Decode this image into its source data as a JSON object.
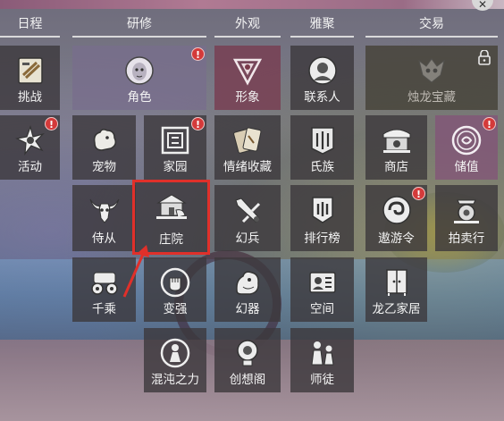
{
  "headers": {
    "schedule": "日程",
    "training": "研修",
    "appearance": "外观",
    "gathering": "雅聚",
    "trade": "交易"
  },
  "tiles": {
    "challenge": "挑战",
    "character": "角色",
    "image": "形象",
    "contacts": "联系人",
    "dragon_treasure": "烛龙宝藏",
    "activity": "活动",
    "pet": "宠物",
    "home": "家园",
    "emotion_collection": "情绪收藏",
    "clan": "氏族",
    "shop": "商店",
    "recharge": "储值",
    "attendant": "侍从",
    "manor": "庄院",
    "phantom_weapon": "幻兵",
    "leaderboard": "排行榜",
    "travel_token": "遨游令",
    "auction": "拍卖行",
    "mounts": "千乘",
    "strengthen": "变强",
    "phantom_artifact": "幻器",
    "space": "空间",
    "dragon_home": "龙乙家居",
    "chaos_power": "混沌之力",
    "creation_pavilion": "创想阁",
    "mentor": "师徒"
  },
  "badge_text": "!",
  "colors": {
    "badge": "#d43a3a",
    "highlight": "#e0302a",
    "header_line": "#ebebeb"
  },
  "icons": {
    "challenge": "scroll-icon",
    "character": "mask-face-icon",
    "image": "emblem-icon",
    "contacts": "contact-face-icon",
    "dragon_treasure": "dragon-skull-icon",
    "activity": "star-burst-icon",
    "pet": "pet-icon",
    "home": "gate-icon",
    "emotion_collection": "cards-icon",
    "clan": "clan-banner-icon",
    "shop": "shop-stall-icon",
    "recharge": "coin-icon",
    "attendant": "bull-skull-icon",
    "manor": "manor-house-icon",
    "phantom_weapon": "weapon-icon",
    "leaderboard": "banner-icon",
    "travel_token": "swirl-token-icon",
    "auction": "auction-bell-icon",
    "mounts": "vehicle-icon",
    "strengthen": "fist-icon",
    "phantom_artifact": "beast-icon",
    "space": "id-card-icon",
    "dragon_home": "wardrobe-icon",
    "chaos_power": "figure-icon",
    "creation_pavilion": "lightbulb-icon",
    "mentor": "master-student-icon",
    "lock": "lock-icon",
    "arrow": "arrow-icon"
  }
}
